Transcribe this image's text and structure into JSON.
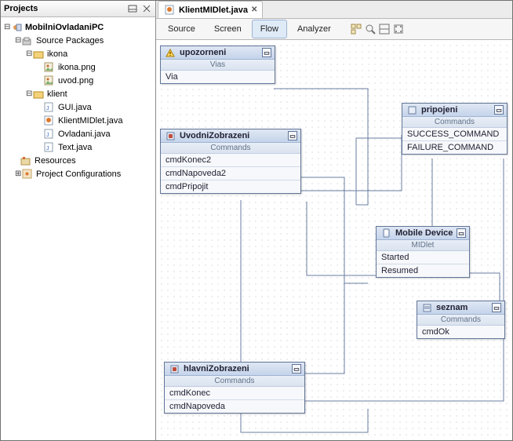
{
  "projects_panel": {
    "title": "Projects",
    "tree": {
      "root": "MobilniOvladaniPC",
      "source_packages": "Source Packages",
      "pkg_ikona": "ikona",
      "ikona_png": "ikona.png",
      "uvod_png": "uvod.png",
      "pkg_klient": "klient",
      "gui_java": "GUI.java",
      "klientmidlet_java": "KlientMIDlet.java",
      "ovladani_java": "Ovladani.java",
      "text_java": "Text.java",
      "resources": "Resources",
      "project_config": "Project Configurations"
    }
  },
  "editor_tab": {
    "filename": "KlientMIDlet.java"
  },
  "modes": {
    "source": "Source",
    "screen": "Screen",
    "flow": "Flow",
    "analyzer": "Analyzer"
  },
  "nodes": {
    "upozorneni": {
      "title": "upozorneni",
      "sub": "Vias",
      "row0": "Via"
    },
    "pripojeni": {
      "title": "pripojeni",
      "sub": "Commands",
      "row0": "SUCCESS_COMMAND",
      "row1": "FAILURE_COMMAND"
    },
    "uvodni": {
      "title": "UvodniZobrazeni",
      "sub": "Commands",
      "row0": "cmdKonec2",
      "row1": "cmdNapoveda2",
      "row2": "cmdPripojit"
    },
    "mobile": {
      "title": "Mobile Device",
      "sub": "MIDlet",
      "row0": "Started",
      "row1": "Resumed"
    },
    "seznam": {
      "title": "seznam",
      "sub": "Commands",
      "row0": "cmdOk"
    },
    "hlavni": {
      "title": "hlavniZobrazeni",
      "sub": "Commands",
      "row0": "cmdKonec",
      "row1": "cmdNapoveda"
    }
  }
}
